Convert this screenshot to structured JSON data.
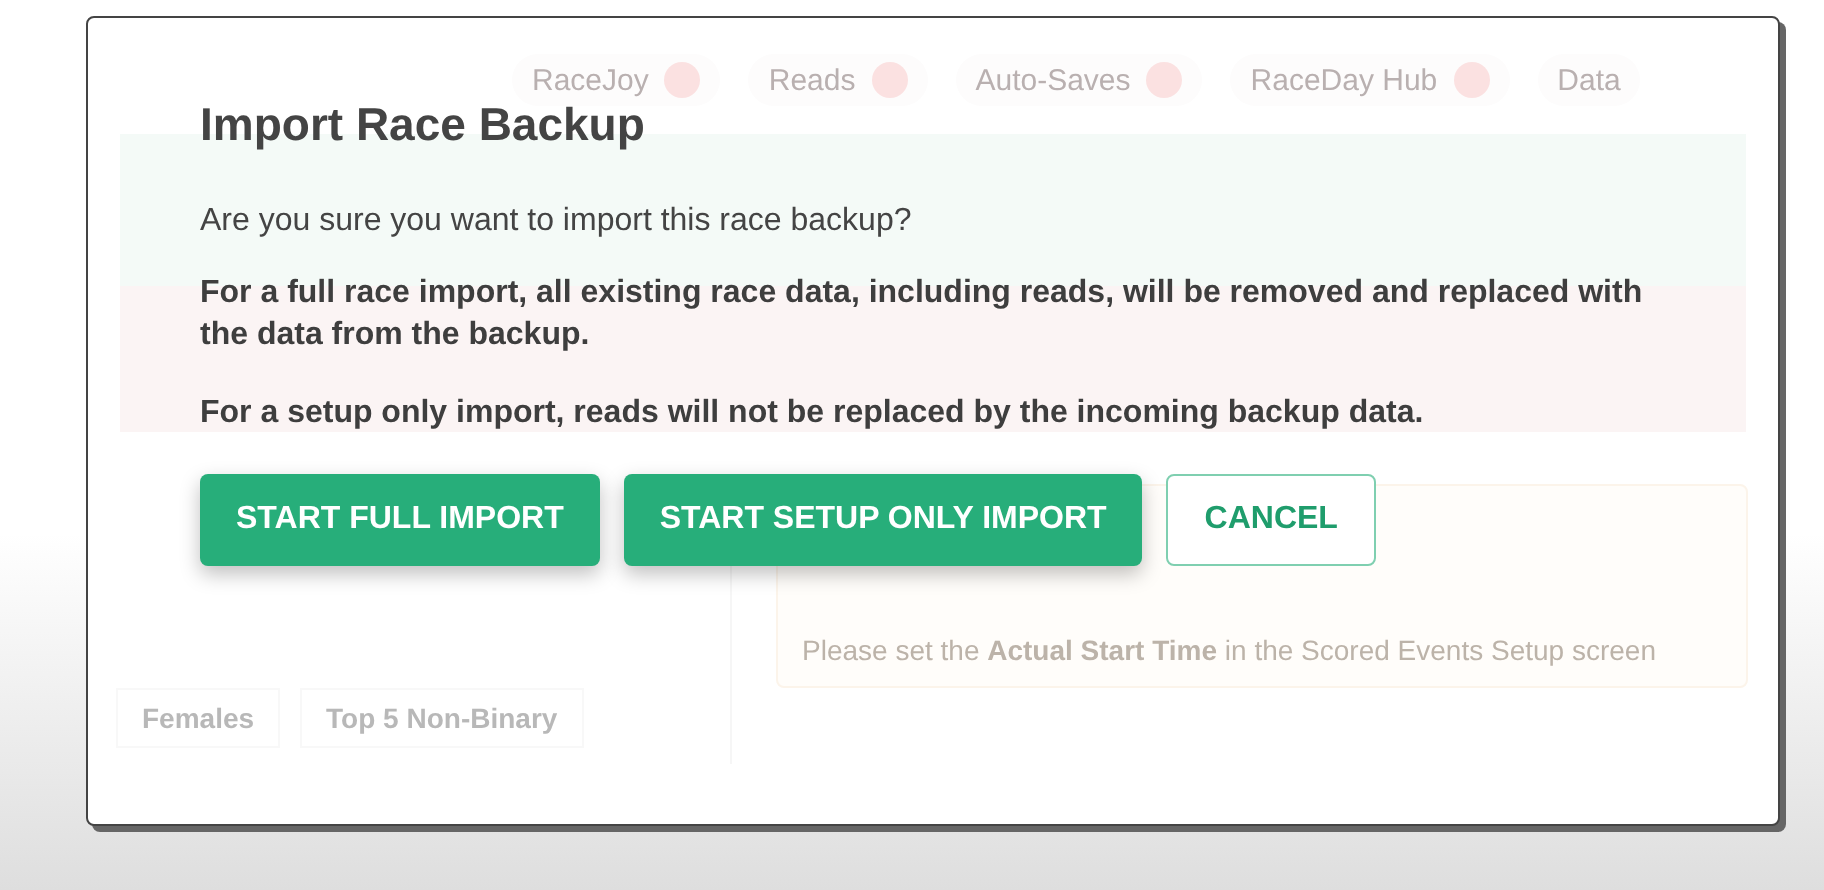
{
  "background": {
    "tabs": [
      {
        "label": "RaceJoy",
        "color": "#fbe1e1"
      },
      {
        "label": "Reads",
        "color": "#fbe1e1"
      },
      {
        "label": "Auto-Saves",
        "color": "#fbe1e1"
      },
      {
        "label": "RaceDay Hub",
        "color": "#fbe1e1"
      },
      {
        "label": "Data"
      }
    ],
    "notice": "Please set the **Actual Start Time** in the Scored Events Setup screen",
    "bottom_tabs": [
      "Females",
      "Top 5 Non-Binary"
    ]
  },
  "dialog": {
    "title": "Import Race Backup",
    "question": "Are you sure you want to import this race backup?",
    "paragraphs": [
      "For a full race import, all existing race data, including reads, will be removed and replaced with the data from the backup.",
      "For a setup only import, reads will not be replaced by the incoming backup data."
    ],
    "buttons": [
      {
        "label": "START FULL IMPORT",
        "kind": "primary"
      },
      {
        "label": "START SETUP ONLY IMPORT",
        "kind": "primary"
      },
      {
        "label": "CANCEL",
        "kind": "outline"
      }
    ]
  }
}
